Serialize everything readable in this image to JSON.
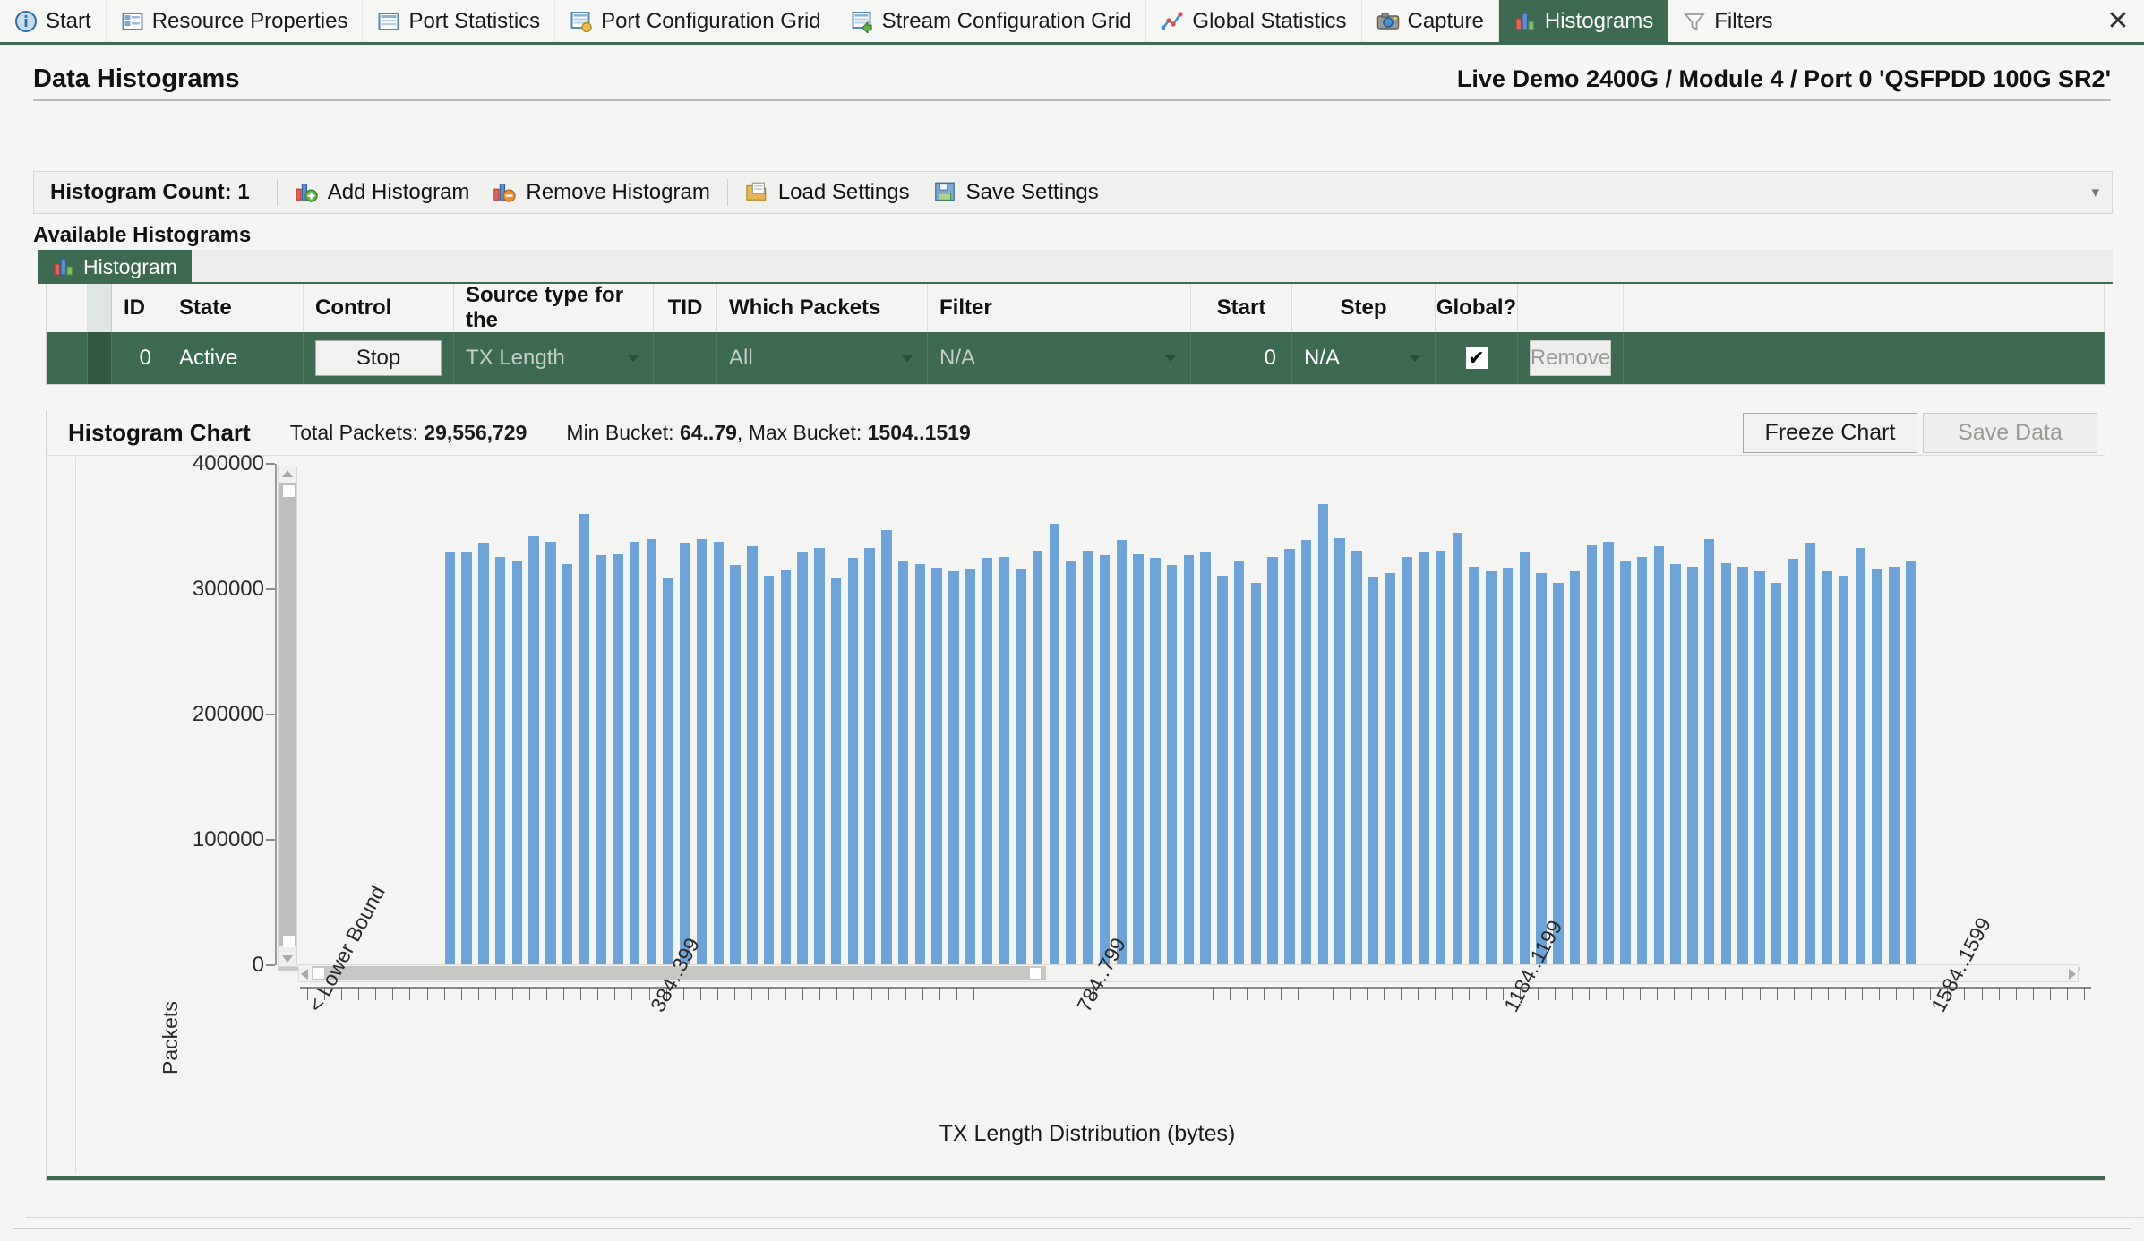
{
  "tabbar": {
    "tabs": [
      {
        "label": "Start",
        "icon": "info-icon",
        "active": false
      },
      {
        "label": "Resource Properties",
        "icon": "properties-grid-icon",
        "active": false
      },
      {
        "label": "Port Statistics",
        "icon": "table-icon",
        "active": false
      },
      {
        "label": "Port Configuration Grid",
        "icon": "table-gold-icon",
        "active": false
      },
      {
        "label": "Stream Configuration Grid",
        "icon": "table-green-icon",
        "active": false
      },
      {
        "label": "Global Statistics",
        "icon": "line-chart-icon",
        "active": false
      },
      {
        "label": "Capture",
        "icon": "camera-icon",
        "active": false
      },
      {
        "label": "Histograms",
        "icon": "bar-chart-icon",
        "active": true
      },
      {
        "label": "Filters",
        "icon": "funnel-icon",
        "active": false
      }
    ],
    "close_label": "✕"
  },
  "header": {
    "title": "Data Histograms",
    "subtitle": "Live Demo 2400G / Module 4 / Port 0 'QSFPDD 100G SR2'"
  },
  "toolbar": {
    "histogram_count_label": "Histogram Count:",
    "histogram_count_value": "1",
    "add_label": "Add Histogram",
    "remove_label": "Remove Histogram",
    "load_label": "Load Settings",
    "save_label": "Save Settings",
    "overflow_glyph": "▾"
  },
  "available": {
    "section_label": "Available Histograms",
    "tab_label": "Histogram"
  },
  "grid": {
    "headers": [
      "",
      "",
      "ID",
      "State",
      "Control",
      "Source type for the",
      "TID",
      "Which Packets",
      "Filter",
      "Start",
      "Step",
      "Global?",
      ""
    ],
    "row": {
      "id": "0",
      "state": "Active",
      "control_button": "Stop",
      "source_type": "TX Length",
      "tid": "",
      "which_packets": "All",
      "filter": "N/A",
      "start": "0",
      "step": "N/A",
      "global_checked": true,
      "global_check_glyph": "✔",
      "remove_button": "Remove"
    }
  },
  "chart_header": {
    "title": "Histogram Chart",
    "total_packets_label": "Total Packets:",
    "total_packets_value": "29,556,729",
    "min_bucket_label": "Min Bucket:",
    "min_bucket_value": "64..79",
    "comma": ",",
    "max_bucket_label": "Max Bucket:",
    "max_bucket_value": "1504..1519",
    "freeze_button": "Freeze Chart",
    "save_data_button": "Save Data"
  },
  "chart_data": {
    "type": "bar",
    "title": "Histogram Chart",
    "xlabel": "TX Length Distribution (bytes)",
    "ylabel": "Packets",
    "ylim": [
      0,
      400000
    ],
    "yticks": [
      0,
      100000,
      200000,
      300000,
      400000
    ],
    "ytick_labels": [
      "0",
      "100000",
      "200000",
      "300000",
      "400000"
    ],
    "grid": false,
    "legend": false,
    "bar_color": "#6da3d6",
    "total_packets": 29556729,
    "min_bucket": "64..79",
    "max_bucket": "1504..1519",
    "x_tick_labels": [
      {
        "text": "< Lower Bound",
        "index": 0
      },
      {
        "text": "384..399",
        "index": 20
      },
      {
        "text": "784..799",
        "index": 45
      },
      {
        "text": "1184..1199",
        "index": 70
      },
      {
        "text": "1584..1599",
        "index": 95
      }
    ],
    "leading_empty_bars": 8,
    "trailing_empty_bars": 9,
    "values": [
      330000,
      330000,
      337000,
      326000,
      322000,
      342000,
      338000,
      320000,
      360000,
      327000,
      328000,
      338000,
      340000,
      309000,
      337000,
      340000,
      338000,
      319000,
      334000,
      311000,
      315000,
      330000,
      333000,
      309000,
      325000,
      333000,
      347000,
      323000,
      320000,
      317000,
      314000,
      316000,
      325000,
      326000,
      316000,
      331000,
      352000,
      322000,
      331000,
      327000,
      339000,
      328000,
      325000,
      319000,
      327000,
      330000,
      311000,
      322000,
      305000,
      326000,
      332000,
      339000,
      368000,
      341000,
      331000,
      310000,
      313000,
      326000,
      329000,
      331000,
      345000,
      318000,
      314000,
      317000,
      329000,
      313000,
      305000,
      314000,
      335000,
      338000,
      323000,
      326000,
      334000,
      320000,
      318000,
      340000,
      321000,
      318000,
      314000,
      305000,
      324000,
      337000,
      314000,
      311000,
      333000,
      316000,
      318000,
      322000
    ]
  },
  "xaxis_title": "TX Length Distribution (bytes)",
  "colors": {
    "accent": "#3d6b52",
    "bar": "#6da3d6",
    "panel_bg": "#f4f4f3",
    "row_bg": "#3d6b52"
  }
}
